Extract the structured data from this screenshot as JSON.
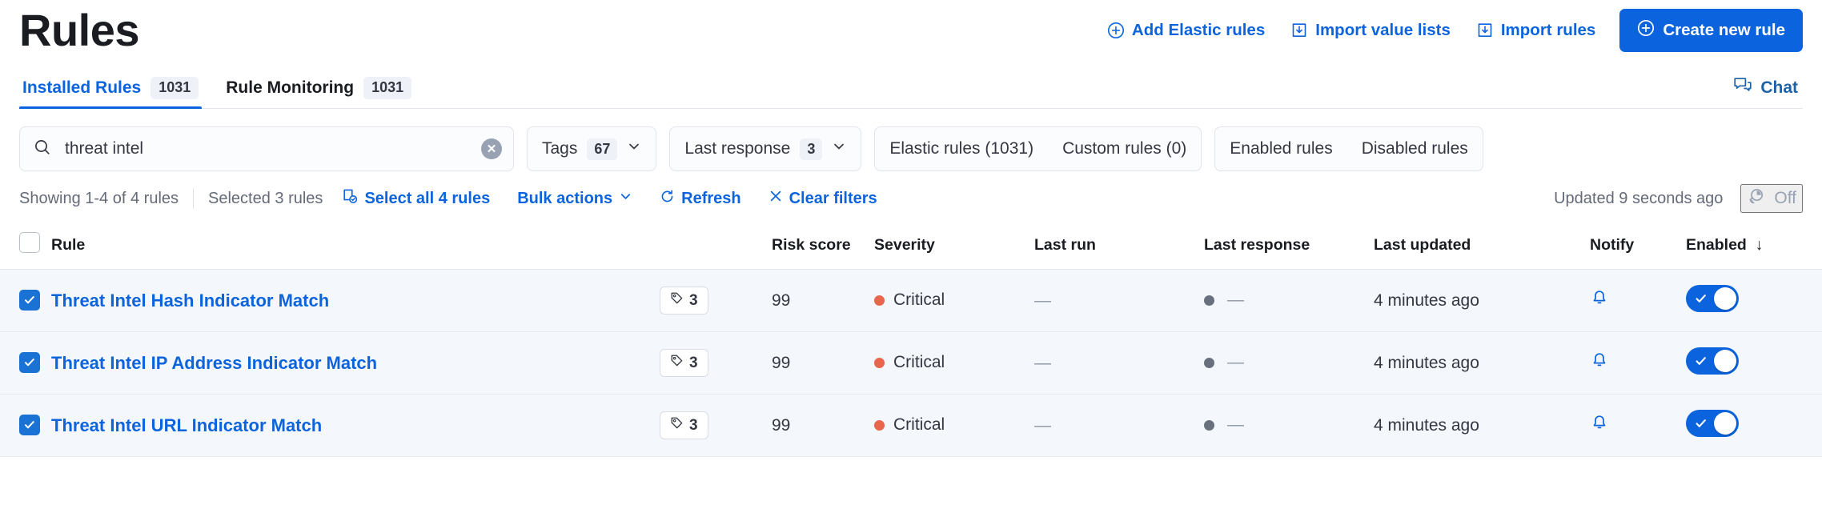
{
  "header": {
    "title": "Rules",
    "actions": [
      {
        "label": "Add Elastic rules",
        "icon": "plus-circle-icon"
      },
      {
        "label": "Import value lists",
        "icon": "import-icon"
      },
      {
        "label": "Import rules",
        "icon": "import-icon"
      }
    ],
    "primary_action": {
      "label": "Create new rule",
      "icon": "plus-circle-icon",
      "color": "#0b64dd"
    }
  },
  "tabs": [
    {
      "label": "Installed Rules",
      "badge": "1031",
      "active": true
    },
    {
      "label": "Rule Monitoring",
      "badge": "1031",
      "active": false
    }
  ],
  "chat": {
    "label": "Chat",
    "icon": "chat-bubbles-icon"
  },
  "filters": {
    "search": {
      "value": "threat intel",
      "placeholder": "Search rules",
      "icon": "search-icon",
      "clear_icon": "clear-icon"
    },
    "tags": {
      "label": "Tags",
      "count": "67"
    },
    "last_response": {
      "label": "Last response",
      "count": "3"
    },
    "source_segments": [
      {
        "label": "Elastic rules (1031)"
      },
      {
        "label": "Custom rules (0)"
      }
    ],
    "state_segments": [
      {
        "label": "Enabled rules"
      },
      {
        "label": "Disabled rules"
      }
    ]
  },
  "utility": {
    "showing": "Showing 1-4 of 4 rules",
    "selected": "Selected 3 rules",
    "select_all": "Select all 4 rules",
    "bulk_actions": "Bulk actions",
    "refresh": "Refresh",
    "clear_filters": "Clear filters",
    "updated": "Updated 9 seconds ago",
    "auto_refresh": "Off"
  },
  "table": {
    "columns": [
      "Rule",
      "Risk score",
      "Severity",
      "Last run",
      "Last response",
      "Last updated",
      "Notify",
      "Enabled"
    ],
    "sort_column": "Enabled",
    "sort_direction": "desc",
    "header_checkbox_checked": false,
    "rows": [
      {
        "selected": true,
        "name": "Threat Intel Hash Indicator Match",
        "tags": "3",
        "risk_score": "99",
        "severity": "Critical",
        "severity_color": "#e7664c",
        "last_run": "—",
        "last_response": "—",
        "last_updated": "4 minutes ago",
        "notify": "bell-icon",
        "enabled": true
      },
      {
        "selected": true,
        "name": "Threat Intel IP Address Indicator Match",
        "tags": "3",
        "risk_score": "99",
        "severity": "Critical",
        "severity_color": "#e7664c",
        "last_run": "—",
        "last_response": "—",
        "last_updated": "4 minutes ago",
        "notify": "bell-icon",
        "enabled": true
      },
      {
        "selected": true,
        "name": "Threat Intel URL Indicator Match",
        "tags": "3",
        "risk_score": "99",
        "severity": "Critical",
        "severity_color": "#e7664c",
        "last_run": "—",
        "last_response": "—",
        "last_updated": "4 minutes ago",
        "notify": "bell-icon",
        "enabled": true
      }
    ]
  }
}
